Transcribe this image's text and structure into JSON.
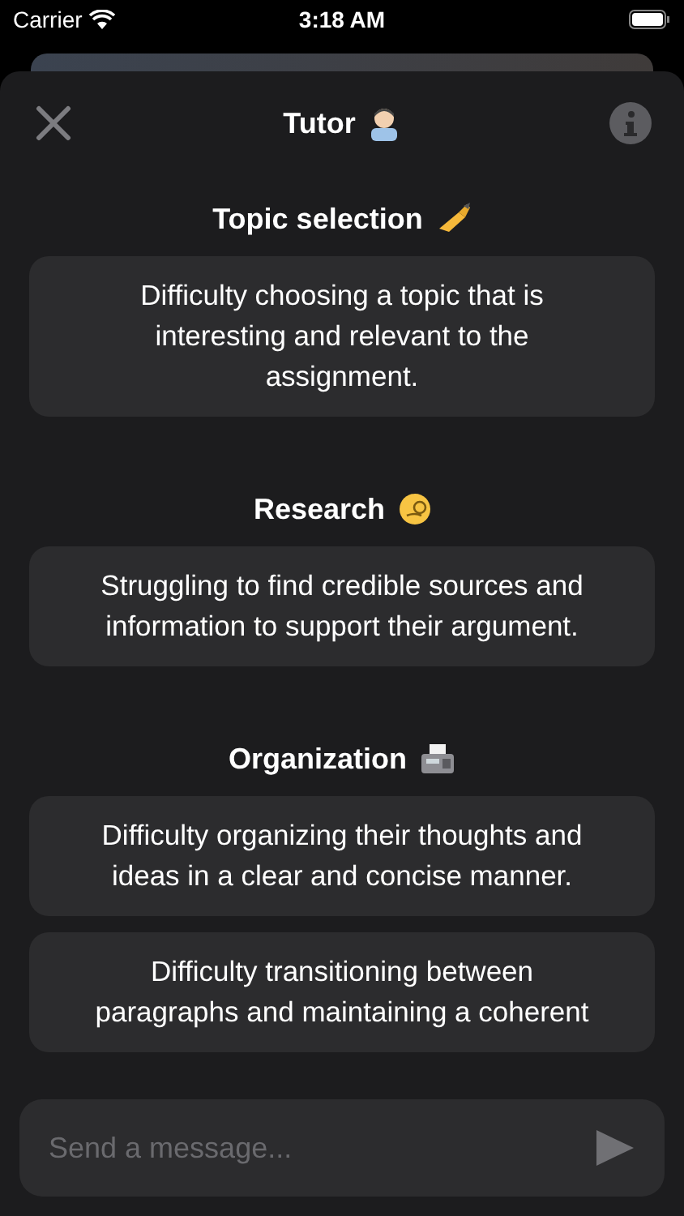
{
  "status_bar": {
    "carrier": "Carrier",
    "time": "3:18 AM"
  },
  "header": {
    "title": "Tutor"
  },
  "sections": [
    {
      "heading": "Topic selection",
      "kind": "writing",
      "cards": [
        "Difficulty choosing a topic that is interesting and relevant to the assignment."
      ]
    },
    {
      "heading": "Research",
      "kind": "monocle",
      "cards": [
        "Struggling to find credible sources and information to support their argument."
      ]
    },
    {
      "heading": "Organization",
      "kind": "fax",
      "cards": [
        "Difficulty organizing their thoughts and ideas in a clear and concise manner.",
        "Difficulty transitioning between paragraphs and maintaining a coherent"
      ]
    }
  ],
  "composer": {
    "placeholder": "Send a message..."
  }
}
